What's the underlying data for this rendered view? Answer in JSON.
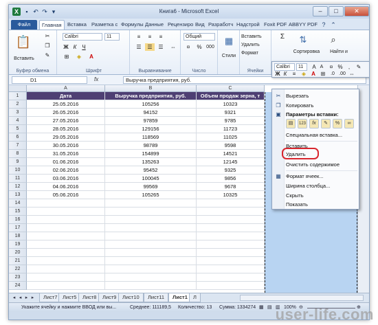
{
  "titlebar": {
    "title": "Книга6 - Microsoft Excel",
    "app_icon": "X"
  },
  "ribbon_tabs": [
    "Файл",
    "Главная",
    "Вставка",
    "Разметка с",
    "Формулы",
    "Данные",
    "Рецензиро",
    "Вид",
    "Разработч",
    "Надстрой",
    "Foxit PDF",
    "ABBYY PDF"
  ],
  "ribbon": {
    "paste_label": "Вставить",
    "clipboard_group": "Буфер обмена",
    "font_name": "Calibri",
    "font_size": "11",
    "font_group": "Шрифт",
    "align_group": "Выравнивание",
    "number_format": "Общий",
    "number_group": "Число",
    "styles_label": "Стили",
    "insert_label": "Вставить",
    "delete_label": "Удалить",
    "format_label": "Формат",
    "cells_group": "Ячейки",
    "sort_label": "Сортировка",
    "find_label": "Найти и"
  },
  "formula_bar": {
    "name_box": "D1",
    "fx": "fx",
    "value": "Выручка предприятия, руб."
  },
  "columns": [
    "A",
    "B",
    "C"
  ],
  "rows": [
    "1",
    "2",
    "3",
    "4",
    "5",
    "6",
    "7",
    "8",
    "9",
    "10",
    "11",
    "12",
    "13",
    "14",
    "15",
    "16",
    "17",
    "18",
    "19",
    "20",
    "21",
    "22",
    "23",
    "24"
  ],
  "table": {
    "headers": [
      "Дата",
      "Выручка предприятия, руб.",
      "Объем продаж зерна, т"
    ],
    "rows": [
      [
        "25.05.2016",
        "105256",
        "10323"
      ],
      [
        "26.05.2016",
        "94152",
        "9321"
      ],
      [
        "27.05.2016",
        "97859",
        "9785"
      ],
      [
        "28.05.2016",
        "129156",
        "11723"
      ],
      [
        "29.05.2016",
        "118569",
        "11025"
      ],
      [
        "30.05.2016",
        "98789",
        "9598"
      ],
      [
        "31.05.2016",
        "154899",
        "14521"
      ],
      [
        "01.06.2016",
        "135263",
        "12145"
      ],
      [
        "02.06.2016",
        "95452",
        "9325"
      ],
      [
        "03.06.2016",
        "100045",
        "9856"
      ],
      [
        "04.06.2016",
        "99569",
        "9678"
      ],
      [
        "05.06.2016",
        "105265",
        "10325"
      ]
    ]
  },
  "mini_toolbar": {
    "font_name": "Calibri",
    "font_size": "11"
  },
  "context_menu": {
    "cut": "Вырезать",
    "copy": "Копировать",
    "paste_options": "Параметры вставки:",
    "paste_special": "Специальная вставка...",
    "insert": "Вставить",
    "delete": "Удалить",
    "clear": "Очистить содержимое",
    "format_cells": "Формат ячеек...",
    "column_width": "Ширина столбца...",
    "hide": "Скрыть",
    "show": "Показать"
  },
  "sheet_tabs": [
    "Лист7",
    "Лист5",
    "Лист8",
    "Лист9",
    "Лист10",
    "Лист11",
    "Лист1",
    "Л"
  ],
  "active_sheet": "Лист1",
  "status": {
    "hint": "Укажите ячейку и нажмите ВВОД или вы...",
    "average": "Среднее: 111189,5",
    "count": "Количество: 13",
    "sum": "Сумма: 1334274",
    "zoom": "100%"
  },
  "watermark": "user-life.com",
  "colors": {
    "header_fill": "#4e3f73",
    "selection": "#b8d4f2",
    "highlight": "#d8262e",
    "file_tab": "#2a5a9c"
  }
}
